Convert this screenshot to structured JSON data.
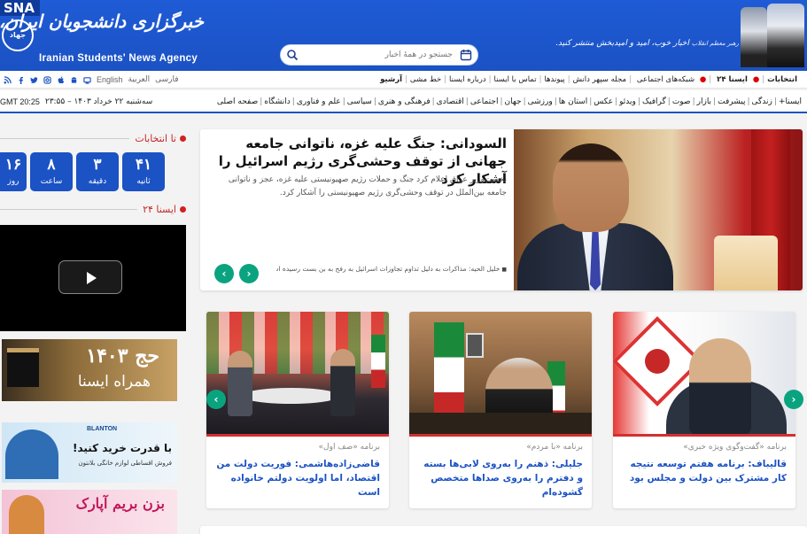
{
  "header": {
    "badge": "SNA",
    "logo_seal": "جهاد",
    "logo_fa": "خبرگزاری دانشجویان ایران، ایسنا",
    "logo_en": "Iranian Students' News Agency",
    "search_placeholder": "جستجو در همهٔ اخبار",
    "quote": "اخبار خوب، امید و امیدبخش منتشر کنید.",
    "quote_sig": "رهبر معظم انقلاب"
  },
  "nav1": {
    "links": [
      "آرشیو",
      "خط مشی",
      "درباره ایسنا",
      "تماس با ایسنا",
      "پیوندها",
      "مجله سپهر دانش",
      "شبکه‌های اجتماعی",
      "ایسنا ۲۴",
      "انتخابات"
    ],
    "languages": [
      "فارسی",
      "العربیة",
      "English"
    ],
    "social_icons": [
      "aparat-icon",
      "android-icon",
      "apple-icon",
      "instagram-icon",
      "twitter-icon",
      "facebook-icon",
      "rss-icon"
    ]
  },
  "nav2": {
    "categories": [
      "صفحه اصلی",
      "دانشگاه",
      "علم و فناوری",
      "سیاسی",
      "فرهنگی و هنری",
      "اقتصادی",
      "اجتماعی",
      "جهان",
      "ورزشی",
      "استان ها",
      "عکس",
      "ویدئو",
      "گرافیک",
      "صوت",
      "بازار",
      "پیشرفت",
      "زندگی",
      "ایسنا+"
    ],
    "date": "سه‌شنبه ۲۲ خرداد ۱۴۰۳ – ۲۳:۵۵",
    "gmt": "GMT 20:25"
  },
  "sidebar": {
    "countdown_title": "تا انتخابات",
    "countdown": [
      {
        "value": "۴۱",
        "unit": "ثانیه"
      },
      {
        "value": "۳",
        "unit": "دقیقه"
      },
      {
        "value": "۸",
        "unit": "ساعت"
      },
      {
        "value": "۱۶",
        "unit": "روز"
      }
    ],
    "isna24_title": "ایسنا ۲۴",
    "hajj_line1": "حج ۱۴۰۳",
    "hajj_line2": "همراه ایسنا",
    "ad1_brand": "BLANTON",
    "ad1_headline": "با قدرت خرید کنید!",
    "ad1_sub": "فروش اقساطی لوازم خانگی بلانتون",
    "ad2_headline": "بزن بریم آپارک"
  },
  "featured": {
    "title": "السودانی: جنگ علیه غزه، ناتوانی جامعه جهانی از توقف وحشی‌گری رژیم اسرائیل را آشکار کرد",
    "lead": "نخست‌وزیر عراق اعلام کرد جنگ و حملات رژیم صهیونیستی علیه غزه، عجز و ناتوانی جامعه بین‌الملل در توقف وحشی‌گری رژیم صهیونیستی را آشکار کرد.",
    "ticker": "خلیل الحیه: مذاکرات به دلیل تداوم تجاوزات اسرائیل به رفح به بن بست رسیده است"
  },
  "cards": [
    {
      "program": "برنامه «گفت‌وگوی ویژه خبری»",
      "title": "قالیباف: برنامه هفتم توسعه نتیجه کار مشترک بین دولت و مجلس بود"
    },
    {
      "program": "برنامه «با مردم»",
      "title": "جلیلی: ذهنم را به‌روی لابی‌ها بسته و دفترم را به‌روی صداها متخصص گشوده‌ام"
    },
    {
      "program": "برنامه «صف اول»",
      "title": "قاضی‌زاده‌هاشمی: فوریت دولت من اقتصاد، اما اولویت دولتم خانواده است"
    }
  ],
  "colors": {
    "brand": "#1b52c4",
    "accent_green": "#0aa37f",
    "alert_red": "#d32020"
  }
}
